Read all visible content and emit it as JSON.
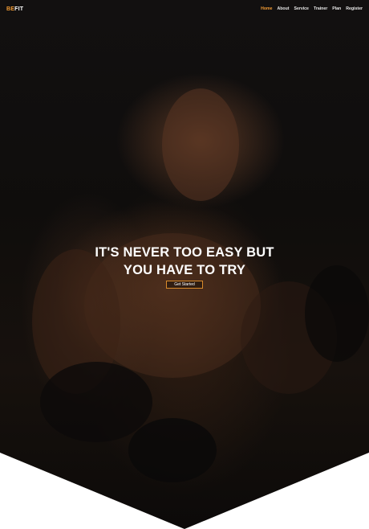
{
  "brand": {
    "prefix": "BE",
    "suffix": "FIT"
  },
  "nav": {
    "items": [
      {
        "label": "Home",
        "active": true
      },
      {
        "label": "About"
      },
      {
        "label": "Service"
      },
      {
        "label": "Trainer"
      },
      {
        "label": "Plan"
      },
      {
        "label": "Register"
      }
    ]
  },
  "hero": {
    "headline_line1": "IT'S NEVER TOO EASY BUT",
    "headline_line2": "YOU HAVE TO TRY",
    "cta_label": "Get Started"
  },
  "colors": {
    "accent": "#f39c34",
    "background": "#ffffff",
    "hero_dark": "#121010"
  }
}
